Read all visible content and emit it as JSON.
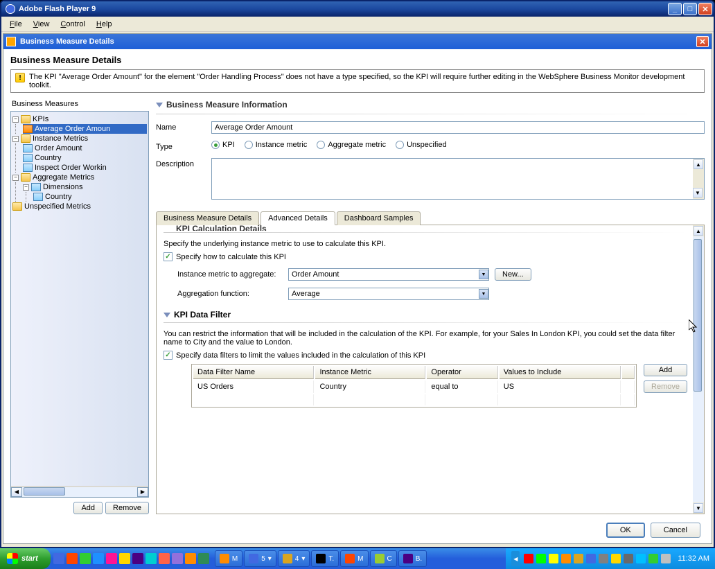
{
  "outer": {
    "title": "Adobe Flash Player 9"
  },
  "menubar": [
    "File",
    "View",
    "Control",
    "Help"
  ],
  "doc": {
    "title": "Business Measure Details",
    "page_title": "Business Measure Details",
    "warning": "The KPI \"Average Order Amount\" for the element \"Order Handling Process\" does not have a type specified, so the KPI will require further editing in the WebSphere Business Monitor development toolkit."
  },
  "tree": {
    "label": "Business Measures",
    "nodes": {
      "kpis": "KPIs",
      "avg_order_amount": "Average Order Amoun",
      "instance_metrics": "Instance Metrics",
      "order_amount": "Order Amount",
      "country": "Country",
      "inspect_order_working": "Inspect Order Workin",
      "aggregate_metrics": "Aggregate Metrics",
      "dimensions": "Dimensions",
      "dim_country": "Country",
      "unspecified_metrics": "Unspecified Metrics"
    },
    "buttons": {
      "add": "Add",
      "remove": "Remove"
    }
  },
  "info": {
    "header": "Business Measure Information",
    "name_label": "Name",
    "name_value": "Average Order Amount",
    "type_label": "Type",
    "type_options": {
      "kpi": "KPI",
      "instance": "Instance metric",
      "aggregate": "Aggregate metric",
      "unspecified": "Unspecified"
    },
    "type_selected": "kpi",
    "desc_label": "Description"
  },
  "tabs": {
    "details": "Business Measure Details",
    "advanced": "Advanced Details",
    "dashboard": "Dashboard Samples",
    "active": "advanced"
  },
  "calc": {
    "header_cut": "KPI Calculation Details",
    "instruction": "Specify the underlying instance metric to use to calculate this KPI.",
    "specify_label": "Specify how to calculate this KPI",
    "metric_label": "Instance metric to aggregate:",
    "metric_value": "Order Amount",
    "new_btn": "New...",
    "func_label": "Aggregation function:",
    "func_value": "Average"
  },
  "filter": {
    "header": "KPI Data Filter",
    "instruction": "You can restrict the information that will be included in the calculation of the KPI.  For example, for your Sales In London KPI, you could set the data filter name to City and the value to London.",
    "specify_label": "Specify data filters to limit the values included in the calculation of this KPI",
    "columns": [
      "Data Filter Name",
      "Instance Metric",
      "Operator",
      "Values to Include"
    ],
    "rows": [
      {
        "name": "US Orders",
        "metric": "Country",
        "operator": "equal to",
        "value": "US"
      }
    ],
    "add_btn": "Add",
    "remove_btn": "Remove"
  },
  "footer": {
    "ok": "OK",
    "cancel": "Cancel"
  },
  "taskbar": {
    "start": "start",
    "clock": "11:32 AM",
    "items": [
      {
        "label": "M",
        "color": "#ff8c00"
      },
      {
        "label": "5",
        "color": "#4169e1"
      },
      {
        "label": "4",
        "color": "#daa520"
      },
      {
        "label": "T.",
        "color": "#000"
      },
      {
        "label": "M",
        "color": "#ff4500"
      },
      {
        "label": "C",
        "color": "#9acd32"
      },
      {
        "label": "B.",
        "color": "#4b0082"
      }
    ]
  }
}
